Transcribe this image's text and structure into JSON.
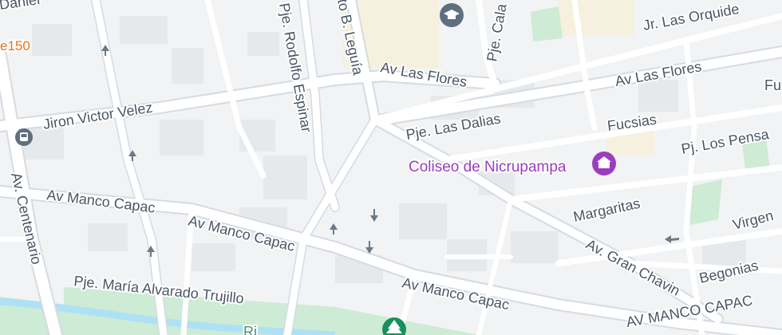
{
  "colors": {
    "background": "#f1f3f4",
    "block": "#e6e9ec",
    "road": "#ffffff",
    "road_border": "#d5dbe1",
    "major_road": "#c9d3dc",
    "park": "#cdebd5",
    "river": "#aee1f5",
    "beige": "#f6f0df",
    "poi_purple": "#9b3dbf",
    "edu_icon": "#5f6f7f",
    "tree_icon": "#17915a"
  },
  "labels": {
    "daniel": "Daniel",
    "ref150": "e150",
    "jiron_victor_velez": "Jiron Victor Velez",
    "pje_rodolfo_espinar": "Pje. Rodolfo Espinar",
    "augusto_leguia": "to B. Leguía",
    "pje_cala": "Pje. Cala",
    "jr_las_orquideas": "Jr. Las Orquide",
    "av_las_flores_1": "Av Las Flores",
    "av_las_flores_2": "Av Las Flores",
    "fu": "Fu",
    "pje_las_dalias": "Pje. Las Dalias",
    "fucsias": "Fucsias",
    "pj_los_pensa": "Pj. Los Pensa",
    "av_manco_capac_1": "Av Manco Capac",
    "av_manco_capac_2": "Av Manco Capac",
    "av_manco_capac_3": "Av Manco Capac",
    "av_manco_capac_4": "AV MANCO CAPAC",
    "av_centenario": "Av. Centenario",
    "margaritas": "Margaritas",
    "virgen": "Virgen",
    "av_gran_chavin": "Av. Gran Chavin",
    "begonias": "Begonias",
    "pje_maria_alvarado_trujillo": "Pje. María Alvarado Trujillo",
    "ri": "Ri"
  },
  "poi": {
    "coliseo_name": "Coliseo de Nicrupampa"
  },
  "icons": {
    "school": "graduation-cap-icon",
    "stadium": "stadium-icon",
    "bus": "bus-stop-icon",
    "tree": "park-tree-icon",
    "arrows": "one-way-arrow-icon"
  }
}
